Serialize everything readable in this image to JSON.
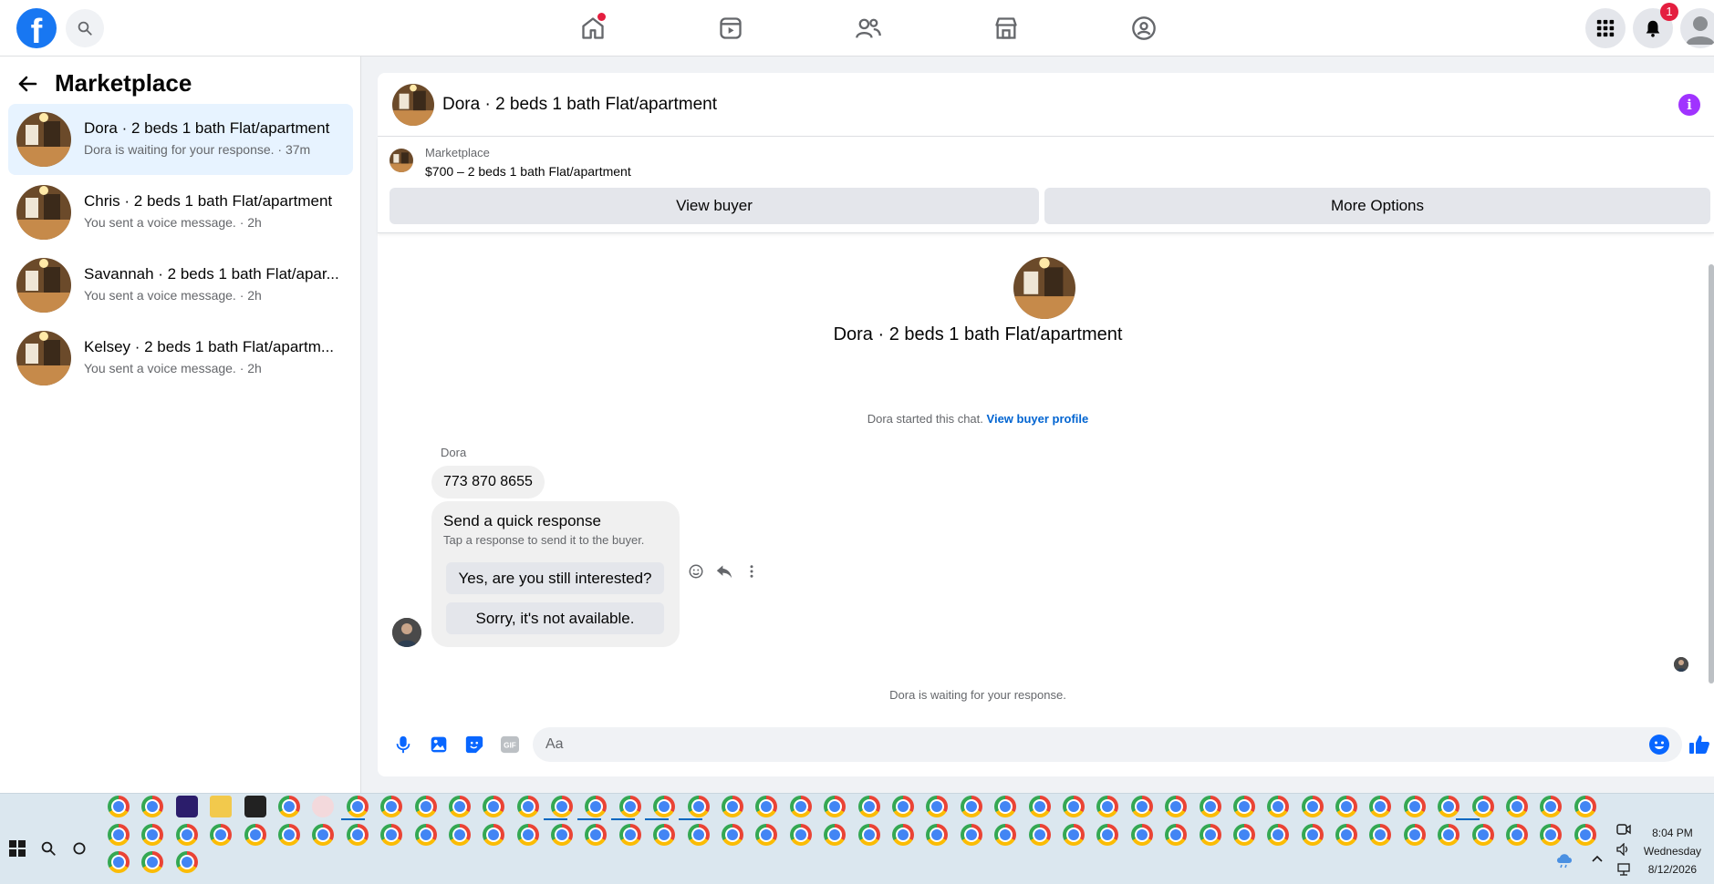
{
  "sidebar": {
    "title": "Marketplace",
    "conversations": [
      {
        "title": "Dora · 2 beds 1 bath Flat/apartment",
        "subtitle": "Dora is waiting for your response. · 37m"
      },
      {
        "title": "Chris · 2 beds 1 bath Flat/apartment",
        "subtitle": "You sent a voice message. · 2h"
      },
      {
        "title": "Savannah · 2 beds 1 bath Flat/apar...",
        "subtitle": "You sent a voice message. · 2h"
      },
      {
        "title": "Kelsey · 2 beds 1 bath Flat/apartm...",
        "subtitle": "You sent a voice message. · 2h"
      }
    ]
  },
  "header": {
    "notification_count": "1"
  },
  "thread": {
    "title": "Dora · 2 beds 1 bath Flat/apartment",
    "listing_source": "Marketplace",
    "listing_price": "$700 – 2 beds 1 bath Flat/apartment",
    "view_buyer": "View buyer",
    "more_options": "More Options",
    "intro_title": "Dora · 2 beds 1 bath Flat/apartment",
    "chat_started": "Dora started this chat.",
    "view_buyer_profile": "View buyer profile",
    "sender": "Dora",
    "message": "773 870 8655",
    "quick_title": "Send a quick response",
    "quick_subtitle": "Tap a response to send it to the buyer.",
    "quick_reply_1": "Yes, are you still interested?",
    "quick_reply_2": "Sorry, it's not available.",
    "waiting": "Dora is waiting for your response.",
    "composer_placeholder": "Aa"
  },
  "taskbar": {
    "time": "8:04 PM",
    "day": "Wednesday",
    "date": "8/12/2026"
  },
  "colors": {
    "brand": "#1877f2",
    "info": "#a033ff",
    "active_item": "#e7f3ff",
    "link": "#0064d1"
  }
}
